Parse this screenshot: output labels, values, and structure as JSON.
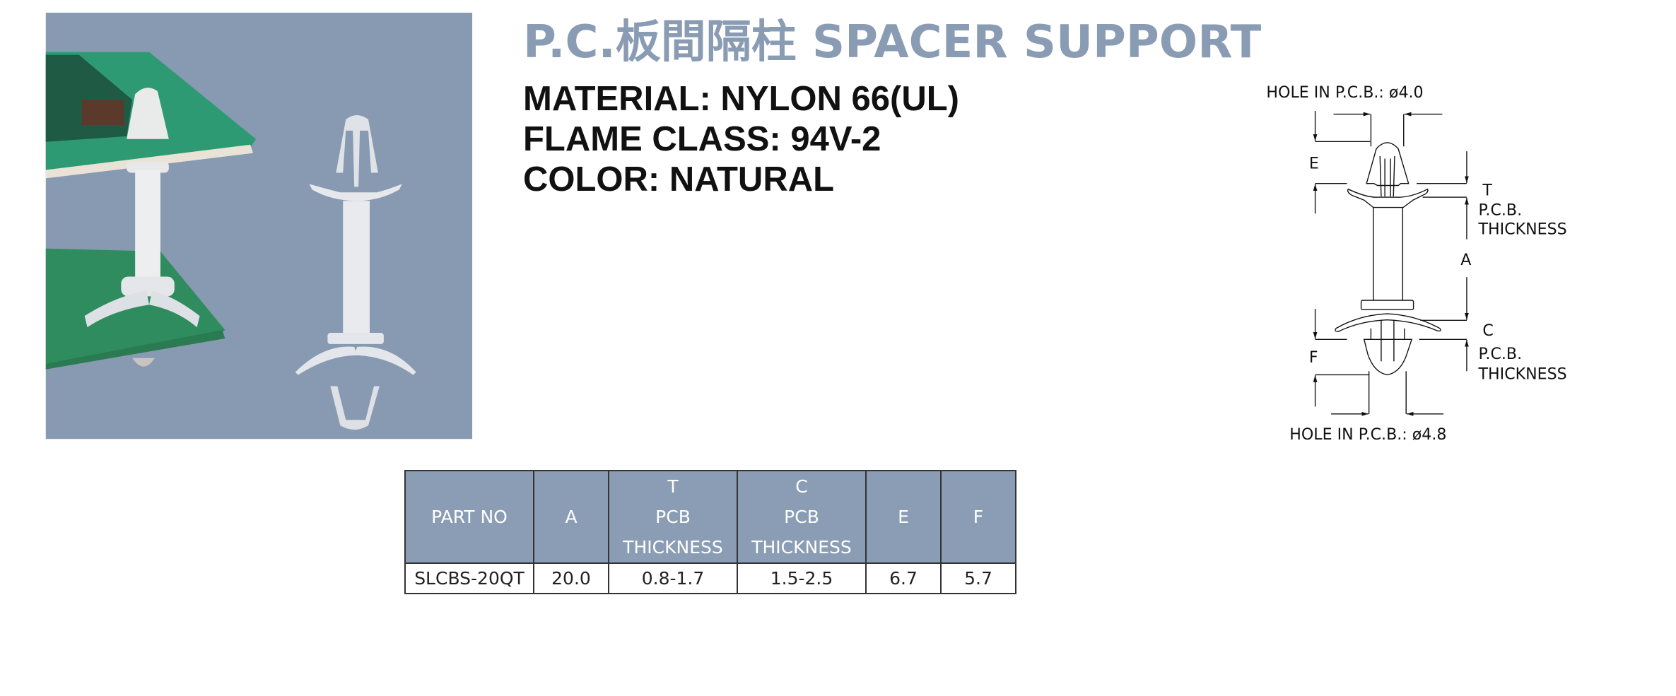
{
  "title": "P.C.板間隔柱 SPACER SUPPORT",
  "specs": [
    "MATERIAL: NYLON 66(UL)",
    "FLAME CLASS: 94V-2",
    "COLOR: NATURAL"
  ],
  "table": {
    "headers": [
      {
        "lines": [
          "PART NO"
        ]
      },
      {
        "lines": [
          "A"
        ]
      },
      {
        "lines": [
          "T",
          "PCB",
          "THICKNESS"
        ]
      },
      {
        "lines": [
          "C",
          "PCB",
          "THICKNESS"
        ]
      },
      {
        "lines": [
          "E"
        ]
      },
      {
        "lines": [
          "F"
        ]
      }
    ],
    "rows": [
      [
        "SLCBS-20QT",
        "20.0",
        "0.8-1.7",
        "1.5-2.5",
        "6.7",
        "5.7"
      ]
    ]
  },
  "diagram": {
    "hole_top": "HOLE IN P.C.B.: ø4.0",
    "hole_bottom": "HOLE IN P.C.B.: ø4.8",
    "label_e": "E",
    "label_f": "F",
    "label_a": "A",
    "label_t": "T",
    "label_c": "C",
    "pcb": "P.C.B.",
    "thickness": "THICKNESS"
  },
  "colors": {
    "accent": "#8a9cb4",
    "header_bg": "#8a9db5",
    "photo_bg": "#8899b2",
    "pcb_green": "#2f9a72"
  }
}
